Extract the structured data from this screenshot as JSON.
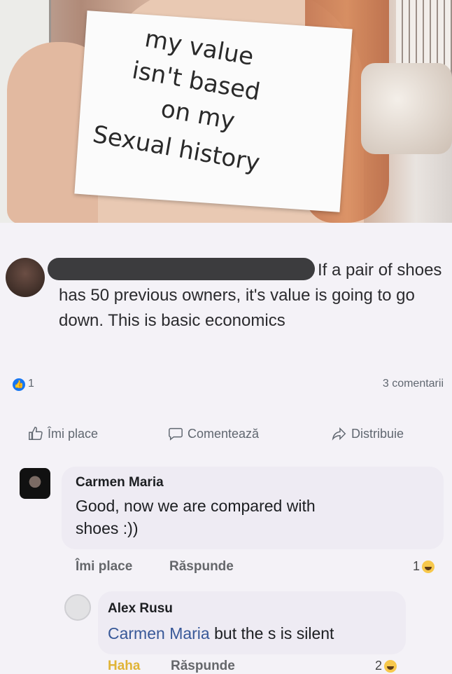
{
  "image": {
    "sign_lines": [
      "my value",
      "isn't based",
      "on my",
      "Sexual history"
    ]
  },
  "post": {
    "author_redacted": true,
    "text": "If a pair of shoes has 50 previous owners, it's value is going to go down. This is basic economics",
    "likes": "1",
    "comments": "3 comentarii"
  },
  "actions": {
    "like": "Îmi place",
    "comment": "Comentează",
    "share": "Distribuie"
  },
  "comments": [
    {
      "name": "Carmen Maria",
      "text_line1": "Good, now we are compared with",
      "text_line2": "shoes :))",
      "like": "Îmi place",
      "reply": "Răspunde",
      "reactions": "1"
    },
    {
      "name": "Alex Rusu",
      "mention": "Carmen Maria",
      "text": " but the s is silent",
      "like": "Haha",
      "reply": "Răspunde",
      "reactions": "2"
    }
  ],
  "colors": {
    "accent": "#1877f2",
    "background": "#f4f2f7",
    "bubble": "#eeebf3"
  }
}
